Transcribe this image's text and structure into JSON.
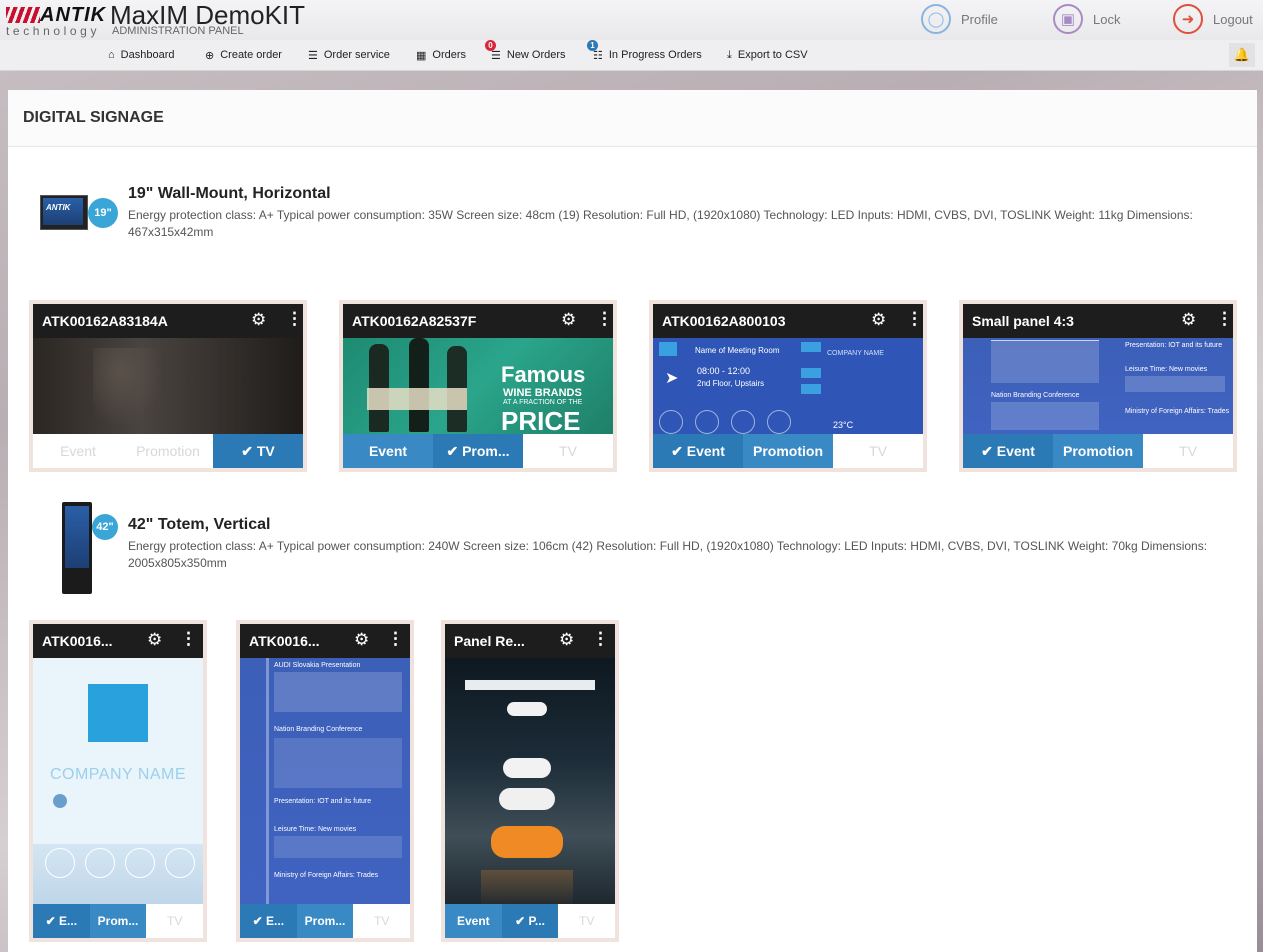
{
  "header": {
    "brand": "ANTIK",
    "brand_sub": "technology",
    "title": "MaxIM DemoKIT",
    "subtitle": "ADMINISTRATION PANEL",
    "actions": [
      {
        "label": "Profile",
        "icon": "user-icon"
      },
      {
        "label": "Lock",
        "icon": "lock-icon"
      },
      {
        "label": "Logout",
        "icon": "logout-icon"
      }
    ]
  },
  "nav": {
    "items": [
      {
        "label": "Dashboard",
        "icon": "home-icon"
      },
      {
        "label": "Create order",
        "icon": "plus-circle-icon"
      },
      {
        "label": "Order service",
        "icon": "list-icon"
      },
      {
        "label": "Orders",
        "icon": "grid-icon"
      },
      {
        "label": "New Orders",
        "icon": "list-badge-icon",
        "badge": "0",
        "badge_color": "#d9273a"
      },
      {
        "label": "In Progress Orders",
        "icon": "clipboard-icon",
        "badge": "1",
        "badge_color": "#2b79b5"
      },
      {
        "label": "Export to CSV",
        "icon": "download-icon"
      }
    ],
    "bell_icon": "bell-icon"
  },
  "page": {
    "title": "DIGITAL SIGNAGE"
  },
  "device_groups": [
    {
      "name": "19\" Wall-Mount, Horizontal",
      "size_badge": "19\"",
      "description": "Energy protection class: A+ Typical power consumption: 35W Screen size: 48cm (19) Resolution: Full HD, (1920x1080) Technology: LED Inputs: HDMI, CVBS, DVI, TOSLINK Weight: 11kg Dimensions: 467x315x42mm",
      "panels": [
        {
          "title": "ATK00162A83184A",
          "buttons": [
            "Event",
            "Promotion",
            "TV"
          ],
          "active": [
            false,
            false,
            true
          ]
        },
        {
          "title": "ATK00162A82537F",
          "buttons": [
            "Event",
            "Prom...",
            "TV"
          ],
          "active": [
            true,
            true,
            false
          ],
          "checked": [
            false,
            true,
            false
          ],
          "preview_text": {
            "line1": "Famous",
            "line2": "WINE BRANDS",
            "line3": "AT A FRACTION OF THE",
            "line4": "PRICE"
          }
        },
        {
          "title": "ATK00162A800103",
          "buttons": [
            "Event",
            "Promotion",
            "TV"
          ],
          "active": [
            true,
            true,
            false
          ],
          "checked": [
            true,
            false,
            false
          ],
          "preview_text": {
            "room": "Name of Meeting Room",
            "time": "08:00 - 12:00",
            "floor": "2nd Floor, Upstairs",
            "company": "COMPANY NAME",
            "temp": "23°C"
          }
        },
        {
          "title": "Small panel 4:3",
          "buttons": [
            "Event",
            "Promotion",
            "TV"
          ],
          "active": [
            true,
            true,
            false
          ],
          "checked": [
            true,
            false,
            false
          ],
          "preview_text": {
            "a": "Presentation: IOT and its future",
            "b": "Leisure Time: New movies",
            "c": "Nation Branding Conference",
            "d": "Ministry of Foreign Affairs: Trades"
          }
        }
      ]
    },
    {
      "name": "42\" Totem, Vertical",
      "size_badge": "42\"",
      "description": "Energy protection class: A+ Typical power consumption: 240W Screen size: 106cm (42) Resolution: Full HD, (1920x1080) Technology: LED Inputs: HDMI, CVBS, DVI, TOSLINK Weight: 70kg Dimensions: 2005x805x350mm",
      "panels": [
        {
          "title": "ATK0016...",
          "buttons": [
            "E...",
            "Prom...",
            "TV"
          ],
          "active": [
            true,
            true,
            false
          ],
          "checked": [
            true,
            false,
            false
          ],
          "preview_text": {
            "company": "COMPANY NAME"
          }
        },
        {
          "title": "ATK0016...",
          "buttons": [
            "E...",
            "Prom...",
            "TV"
          ],
          "active": [
            true,
            true,
            false
          ],
          "checked": [
            true,
            false,
            false
          ],
          "preview_text": {
            "a": "AUDI Slovakia Presentation",
            "b": "Nation Branding Conference",
            "c": "Presentation: IOT and its future",
            "d": "Leisure Time: New movies",
            "e": "Ministry of Foreign Affairs: Trades"
          }
        },
        {
          "title": "Panel Re...",
          "buttons": [
            "Event",
            "P...",
            "TV"
          ],
          "active": [
            true,
            true,
            false
          ],
          "checked": [
            false,
            true,
            false
          ]
        }
      ]
    }
  ],
  "colors": {
    "accent": "#2b79b5",
    "badge": "#3aa6d8",
    "card_border": "#f0e2dd",
    "header_dark": "#1d1d1d"
  }
}
